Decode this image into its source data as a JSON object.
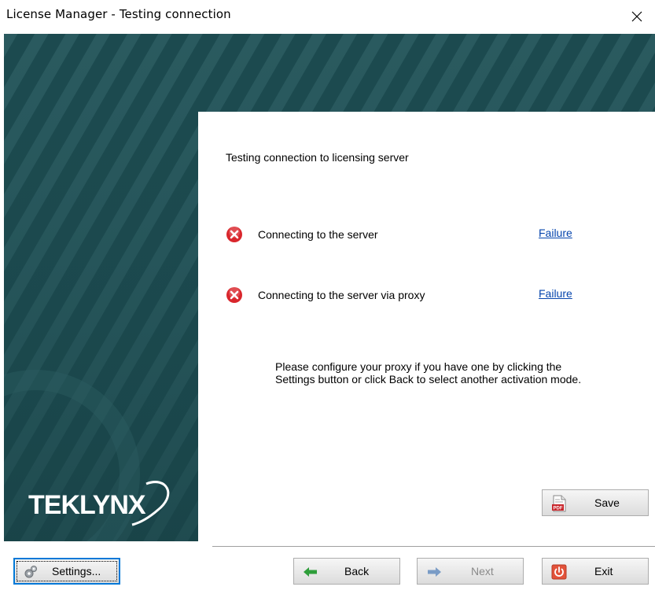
{
  "window": {
    "title": "License Manager - Testing connection",
    "close_icon": "close-icon"
  },
  "banner": {
    "logo_text": "TEKLYNX",
    "background_color": "#1c4a4f"
  },
  "content": {
    "heading": "Testing connection to licensing server",
    "checks": [
      {
        "label": "Connecting to the server",
        "status": "Failure",
        "icon": "error-icon"
      },
      {
        "label": "Connecting to the server via proxy",
        "status": "Failure",
        "icon": "error-icon"
      }
    ],
    "message_lines": [
      "Please configure your proxy if you have one by clicking the",
      "Settings button or click Back to select another activation mode."
    ]
  },
  "buttons": {
    "save": "Save",
    "settings": "Settings...",
    "back": "Back",
    "next": "Next",
    "exit": "Exit"
  },
  "colors": {
    "link": "#0645ad",
    "error": "#d9262c",
    "back_arrow": "#2e9e3a",
    "next_arrow": "#7a9cc6"
  }
}
